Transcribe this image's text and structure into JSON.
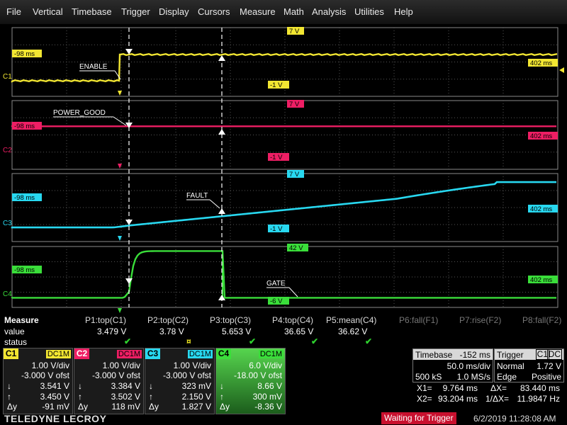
{
  "menu": [
    "File",
    "Vertical",
    "Timebase",
    "Trigger",
    "Display",
    "Cursors",
    "Measure",
    "Math",
    "Analysis",
    "Utilities",
    "Help"
  ],
  "traces": {
    "c1": {
      "label": "C1",
      "top": "7 V",
      "bottom": "-1 V",
      "left_time": "-98 ms",
      "right_time": "402 ms",
      "annotation": "ENABLE",
      "color": "#f2e632"
    },
    "c2": {
      "label": "C2",
      "top": "7 V",
      "bottom": "-1 V",
      "left_time": "-98 ms",
      "right_time": "402 ms",
      "annotation": "POWER_GOOD",
      "color": "#ee1e64"
    },
    "c3": {
      "label": "C3",
      "top": "7 V",
      "bottom": "-1 V",
      "left_time": "-98 ms",
      "right_time": "402 ms",
      "annotation": "FAULT",
      "color": "#28d8f0"
    },
    "c4": {
      "label": "C4",
      "top": "42 V",
      "bottom": "-6 V",
      "left_time": "-98 ms",
      "right_time": "402 ms",
      "annotation": "GATE",
      "color": "#3ade3a"
    }
  },
  "measure": {
    "title": "Measure",
    "row_value": "value",
    "row_status": "status",
    "params": [
      {
        "name": "P1:top(C1)",
        "value": "3.479 V",
        "ok": "✔",
        "active": true
      },
      {
        "name": "P2:top(C2)",
        "value": "3.78 V",
        "ok": "¤",
        "active": true
      },
      {
        "name": "P3:top(C3)",
        "value": "5.653 V",
        "ok": "✔",
        "active": true
      },
      {
        "name": "P4:top(C4)",
        "value": "36.65 V",
        "ok": "✔",
        "active": true
      },
      {
        "name": "P5:mean(C4)",
        "value": "36.62 V",
        "ok": "✔",
        "active": true
      },
      {
        "name": "P6:fall(F1)",
        "value": "",
        "ok": "",
        "active": false
      },
      {
        "name": "P7:rise(F2)",
        "value": "",
        "ok": "",
        "active": false
      },
      {
        "name": "P8:fall(F2)",
        "value": "",
        "ok": "",
        "active": false
      }
    ]
  },
  "channels": [
    {
      "name": "C1",
      "coupling": "DC1M",
      "vdiv": "1.00 V/div",
      "offset": "-3.000 V ofst",
      "min": "3.541 V",
      "max": "3.450 V",
      "dy": "-91 mV",
      "color": "#f2e632"
    },
    {
      "name": "C2",
      "coupling": "DC1M",
      "vdiv": "1.00 V/div",
      "offset": "-3.000 V ofst",
      "min": "3.384 V",
      "max": "3.502 V",
      "dy": "118 mV",
      "color": "#ee1e64"
    },
    {
      "name": "C3",
      "coupling": "DC1M",
      "vdiv": "1.00 V/div",
      "offset": "-3.000 V ofst",
      "min": "323 mV",
      "max": "2.150 V",
      "dy": "1.827 V",
      "color": "#28d8f0"
    },
    {
      "name": "C4",
      "coupling": "DC1M",
      "vdiv": "6.0 V/div",
      "offset": "-18.00 V ofst",
      "min": "8.66 V",
      "max": "300 mV",
      "dy": "-8.36 V",
      "color": "#3ade3a"
    }
  ],
  "timebase": {
    "label": "Timebase",
    "delay": "-152 ms",
    "div": "50.0 ms/div",
    "samples": "500 kS",
    "rate": "1.0 MS/s"
  },
  "trigger": {
    "label": "Trigger",
    "source": "C1",
    "coupling": "DC",
    "mode": "Normal",
    "level": "1.72 V",
    "type": "Edge",
    "slope": "Positive"
  },
  "cursors": {
    "x1_label": "X1=",
    "x1": "9.764 ms",
    "dx_label": "ΔX=",
    "dx": "83.440 ms",
    "x2_label": "X2=",
    "x2": "93.204 ms",
    "inv_label": "1/ΔX=",
    "inv": "11.9847 Hz"
  },
  "status": {
    "logo": "TELEDYNE LECROY",
    "state": "Waiting for Trigger",
    "datetime": "6/2/2019 11:28:08 AM"
  }
}
